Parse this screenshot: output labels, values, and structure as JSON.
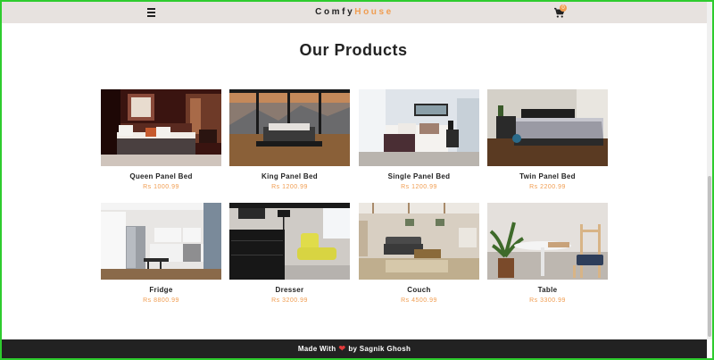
{
  "nav": {
    "logo_part1": "Comfy",
    "logo_part2": "House",
    "cart_count": "0"
  },
  "section_title": "Our Products",
  "products": [
    {
      "name": "Queen Panel Bed",
      "price": "Rs 1000.99"
    },
    {
      "name": "King Panel Bed",
      "price": "Rs 1200.99"
    },
    {
      "name": "Single Panel Bed",
      "price": "Rs 1200.99"
    },
    {
      "name": "Twin Panel Bed",
      "price": "Rs 2200.99"
    },
    {
      "name": "Fridge",
      "price": "Rs 8800.99"
    },
    {
      "name": "Dresser",
      "price": "Rs 3200.99"
    },
    {
      "name": "Couch",
      "price": "Rs 4500.99"
    },
    {
      "name": "Table",
      "price": "Rs 3300.99"
    }
  ],
  "footer": {
    "text_before": "Made With",
    "text_after": "by Sagnik Ghosh",
    "heart_color": "#e23b3b"
  },
  "colors": {
    "accent": "#f09d51",
    "nav_bg": "#e7e2df",
    "footer_bg": "#222222"
  }
}
